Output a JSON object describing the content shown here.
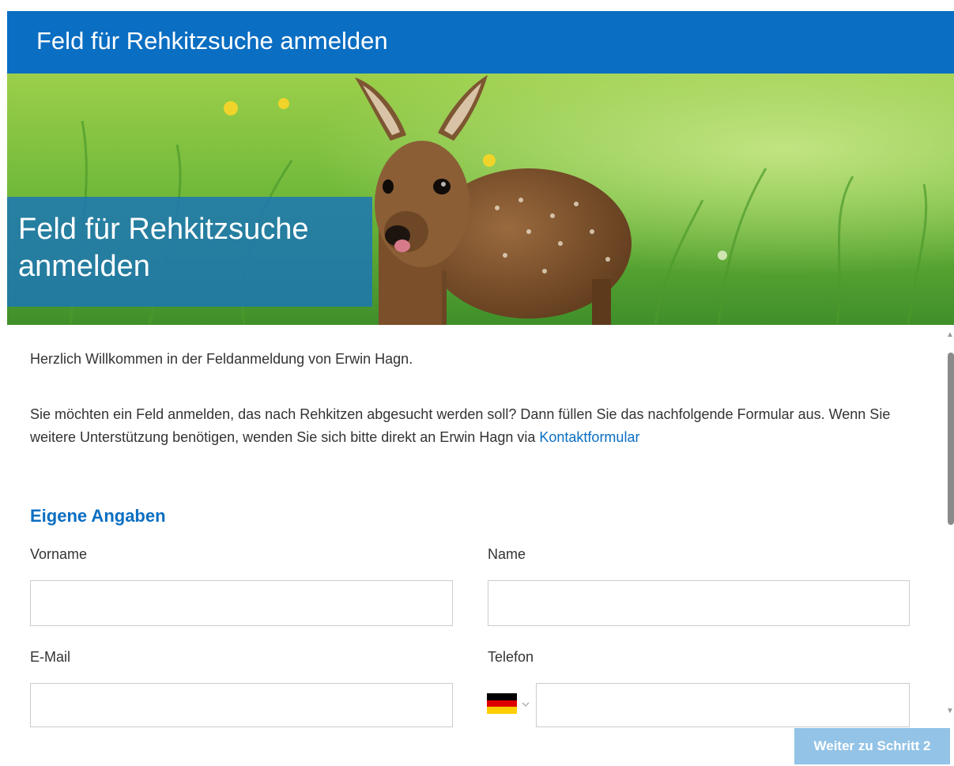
{
  "header": {
    "title": "Feld für Rehkitzsuche anmelden"
  },
  "hero": {
    "caption": "Feld für Rehkitzsuche anmelden",
    "image_subject": "fawn-in-meadow"
  },
  "intro": {
    "welcome": "Herzlich Willkommen in der Feldanmeldung von Erwin Hagn.",
    "instructions": "Sie möchten ein Feld anmelden, das nach Rehkitzen abgesucht werden soll? Dann füllen Sie das nachfolgende Formular aus. Wenn Sie weitere Unterstützung benötigen, wenden Sie sich bitte direkt an Erwin Hagn via",
    "contact_link": "Kontaktformular"
  },
  "form": {
    "section_title": "Eigene Angaben",
    "fields": {
      "first_name": {
        "label": "Vorname",
        "value": ""
      },
      "last_name": {
        "label": "Name",
        "value": ""
      },
      "email": {
        "label": "E-Mail",
        "value": ""
      },
      "phone": {
        "label": "Telefon",
        "value": "",
        "country": "DE"
      }
    }
  },
  "actions": {
    "next_label": "Weiter zu Schritt 2"
  },
  "colors": {
    "brand_blue": "#0a6ec2",
    "caption_overlay": "#1e78af",
    "button_disabled": "#93c3e6"
  },
  "icons": {
    "flag": "germany-flag-icon",
    "dropdown": "chevron-down-icon"
  }
}
